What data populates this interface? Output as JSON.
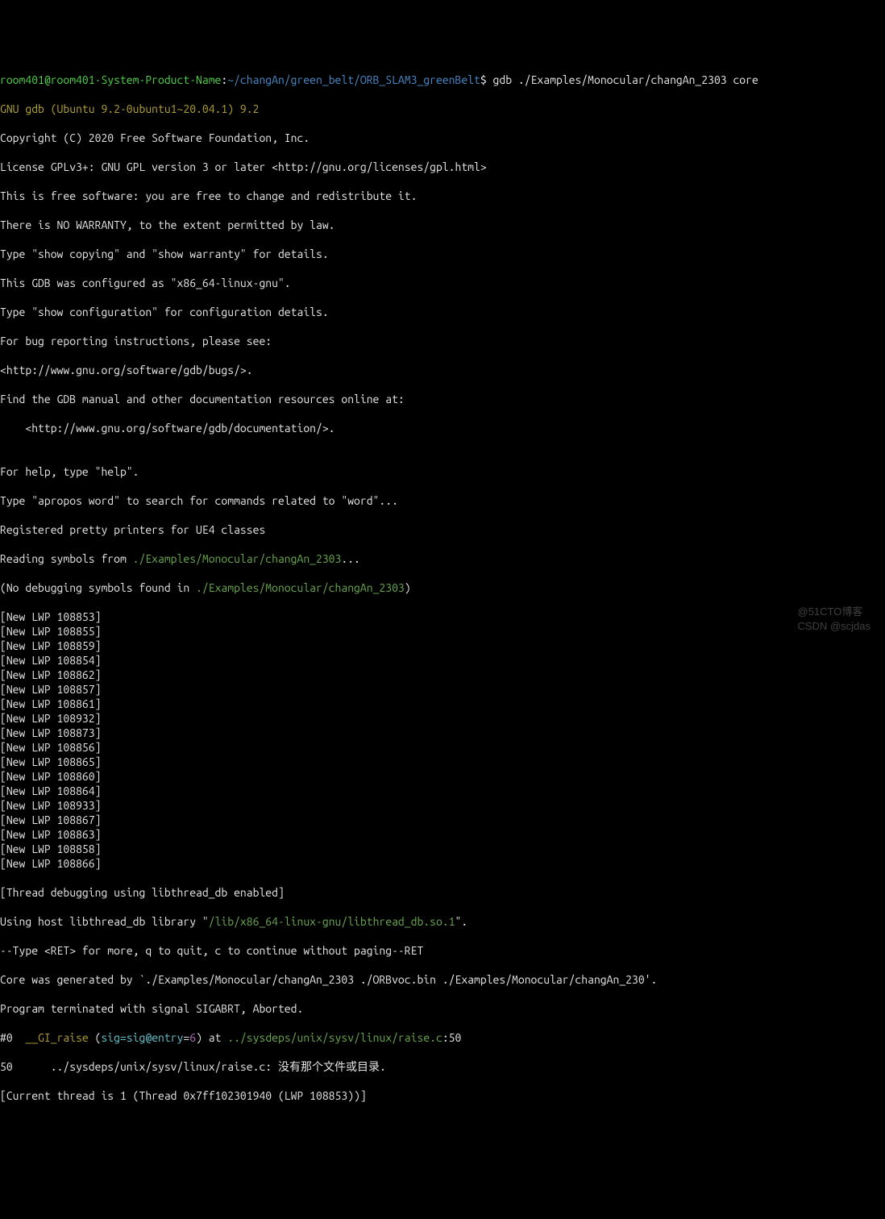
{
  "prompt": {
    "user_host": "room401@room401-System-Product-Name",
    "colon": ":",
    "cwd": "~/changAn/green_belt/ORB_SLAM3_greenBelt",
    "dollar": "$ ",
    "cmd": "gdb ./Examples/Monocular/changAn_2303 core"
  },
  "gdb_header": "GNU gdb (Ubuntu 9.2-0ubuntu1~20.04.1) 9.2",
  "boiler": {
    "l1": "Copyright (C) 2020 Free Software Foundation, Inc.",
    "l2": "License GPLv3+: GNU GPL version 3 or later <http://gnu.org/licenses/gpl.html>",
    "l3": "This is free software: you are free to change and redistribute it.",
    "l4": "There is NO WARRANTY, to the extent permitted by law.",
    "l5": "Type \"show copying\" and \"show warranty\" for details.",
    "l6": "This GDB was configured as \"x86_64-linux-gnu\".",
    "l7": "Type \"show configuration\" for configuration details.",
    "l8": "For bug reporting instructions, please see:",
    "l9": "<http://www.gnu.org/software/gdb/bugs/>.",
    "l10": "Find the GDB manual and other documentation resources online at:",
    "l11": "    <http://www.gnu.org/software/gdb/documentation/>.",
    "l12": "",
    "l13": "For help, type \"help\".",
    "l14": "Type \"apropos word\" to search for commands related to \"word\"...",
    "l15": "Registered pretty printers for UE4 classes"
  },
  "reading": {
    "pre": "Reading symbols from ",
    "path": "./Examples/Monocular/changAn_2303",
    "post": "..."
  },
  "nodbg": {
    "pre": "(No debugging symbols found in ",
    "path": "./Examples/Monocular/changAn_2303",
    "post": ")"
  },
  "lwp_prefix": "[New LWP ",
  "lwp_suffix": "]",
  "lwps": [
    "108853",
    "108855",
    "108859",
    "108854",
    "108862",
    "108857",
    "108861",
    "108932",
    "108873",
    "108856",
    "108865",
    "108860",
    "108864",
    "108933",
    "108867",
    "108863",
    "108858",
    "108866"
  ],
  "thread_db": "[Thread debugging using libthread_db enabled]",
  "hostlib": {
    "pre": "Using host libthread_db library \"",
    "path": "/lib/x86_64-linux-gnu/libthread_db.so.1",
    "post": "\"."
  },
  "pager": "--Type <RET> for more, q to quit, c to continue without paging--RET",
  "core_gen": "Core was generated by `./Examples/Monocular/changAn_2303 ./ORBvoc.bin ./Examples/Monocular/changAn_230'.",
  "term": "Program terminated with signal SIGABRT, Aborted.",
  "frame0": {
    "idx": "#0  ",
    "fn": "__GI_raise",
    "open": " (",
    "arg": "sig=sig@entry",
    "eq": "=",
    "val": "6",
    "close": ") at ",
    "path": "../sysdeps/unix/sysv/linux/raise.c",
    "line": ":50"
  },
  "srcline": "50      ../sysdeps/unix/sysv/linux/raise.c: 没有那个文件或目录.",
  "curthread": "[Current thread is 1 (Thread 0x7ff102301940 (LWP 108853))]",
  "watermark1": "@51CTO博客",
  "watermark2": "CSDN @scjdas"
}
